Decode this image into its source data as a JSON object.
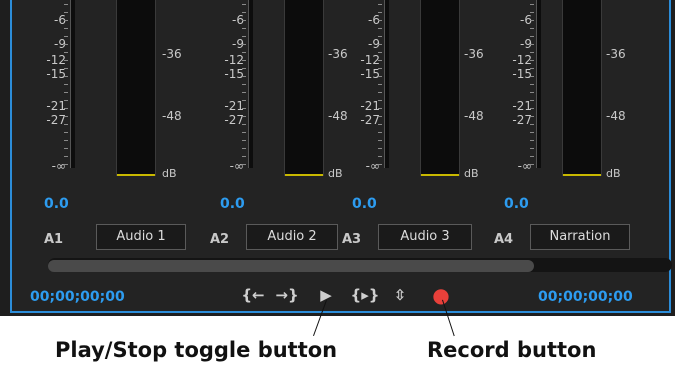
{
  "channels": [
    {
      "id": "A1",
      "name": "Audio 1",
      "volume": "0.0"
    },
    {
      "id": "A2",
      "name": "Audio 2",
      "volume": "0.0"
    },
    {
      "id": "A3",
      "name": "Audio 3",
      "volume": "0.0"
    },
    {
      "id": "A4",
      "name": "Narration",
      "volume": "0.0"
    }
  ],
  "meter_scale": {
    "left": [
      "-6",
      "-9",
      "-12",
      "-15",
      "-21",
      "-27",
      "-∞"
    ],
    "right": [
      "-36",
      "-48",
      "dB"
    ]
  },
  "transport": {
    "timecode_in": "00;00;00;00",
    "timecode_out": "00;00;00;00",
    "buttons": [
      {
        "icon": "go-to-in-icon",
        "glyph": "{←"
      },
      {
        "icon": "go-to-out-icon",
        "glyph": "→}"
      },
      {
        "icon": "play-icon",
        "glyph": "▶"
      },
      {
        "icon": "play-in-to-out-icon",
        "glyph": "{▸}"
      },
      {
        "icon": "loop-icon",
        "glyph": "⇳"
      },
      {
        "icon": "record-icon",
        "glyph": "●"
      }
    ]
  },
  "colors": {
    "accent": "#2c8dd9",
    "timecode": "#2d9cf0",
    "record": "#e8403a",
    "meter_level": "#c8b800"
  },
  "callouts": {
    "play": "Play/Stop toggle button",
    "record": "Record button"
  }
}
